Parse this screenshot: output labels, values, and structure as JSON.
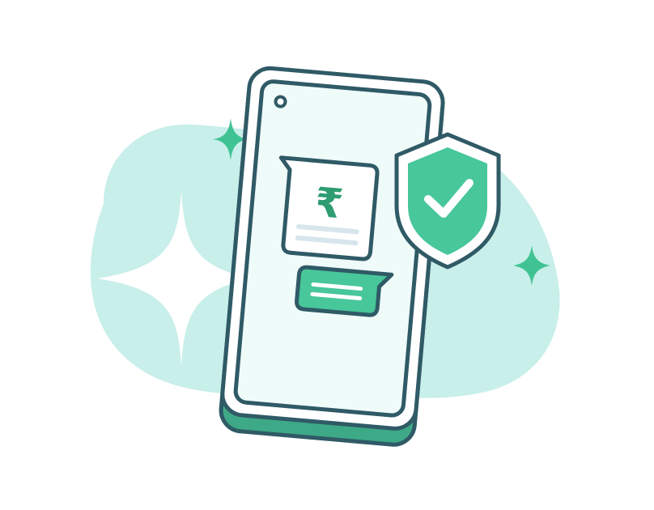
{
  "illustration": {
    "subject": "secure-payment-phone",
    "currency_symbol": "₹",
    "icons": [
      "phone-icon",
      "shield-check-icon",
      "rupee-icon",
      "sparkle-icon",
      "message-bubble-icon"
    ],
    "colors": {
      "background_blob": "#c8efea",
      "outline": "#2f5a66",
      "phone_screen": "#effbf9",
      "accent_green": "#47c79a",
      "accent_green_dark": "#3ea986",
      "sparkle_green": "#40c393",
      "sparkle_white": "#ffffff",
      "text_lines": "#d6e6ec",
      "currency_green": "#2f9c72"
    }
  }
}
